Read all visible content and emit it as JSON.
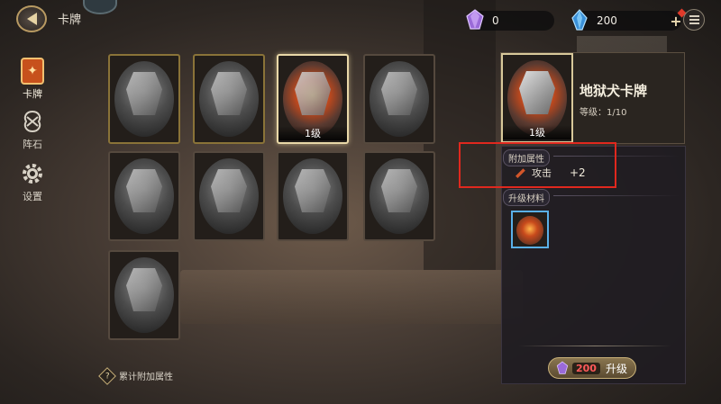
{
  "header": {
    "title": "卡牌",
    "currencies": [
      {
        "icon": "purple-gem-icon",
        "value": "0",
        "color": "#9a6ad8"
      },
      {
        "icon": "blue-gem-icon",
        "value": "200",
        "color": "#4aa8e8"
      }
    ]
  },
  "nav": {
    "items": [
      {
        "label": "卡牌",
        "icon": "card-icon",
        "active": true
      },
      {
        "label": "阵石",
        "icon": "rune-icon",
        "active": false
      },
      {
        "label": "设置",
        "icon": "gear-icon",
        "active": false
      }
    ]
  },
  "cards": [
    {
      "frame": "gold",
      "owned": false
    },
    {
      "frame": "gold",
      "owned": false
    },
    {
      "frame": "selected",
      "owned": true,
      "level": "1级"
    },
    {
      "frame": "normal",
      "owned": false
    },
    {
      "frame": "normal",
      "owned": false
    },
    {
      "frame": "normal",
      "owned": false
    },
    {
      "frame": "normal",
      "owned": false
    },
    {
      "frame": "normal",
      "owned": false
    },
    {
      "frame": "normal",
      "owned": false
    }
  ],
  "detail": {
    "name": "地狱犬卡牌",
    "level_text": "等级：1/10",
    "portrait_level": "1级",
    "bonus_section_label": "附加属性",
    "bonus_attr_label": "攻击",
    "bonus_attr_value": "+2",
    "materials_section_label": "升级材料",
    "upgrade_cost": "200",
    "upgrade_label": "升级"
  },
  "footer": {
    "hint": "累计附加属性"
  },
  "colors": {
    "highlight_border": "#e0281e",
    "cost_text": "#ff5a5a",
    "material_border": "#5ab0e8"
  }
}
